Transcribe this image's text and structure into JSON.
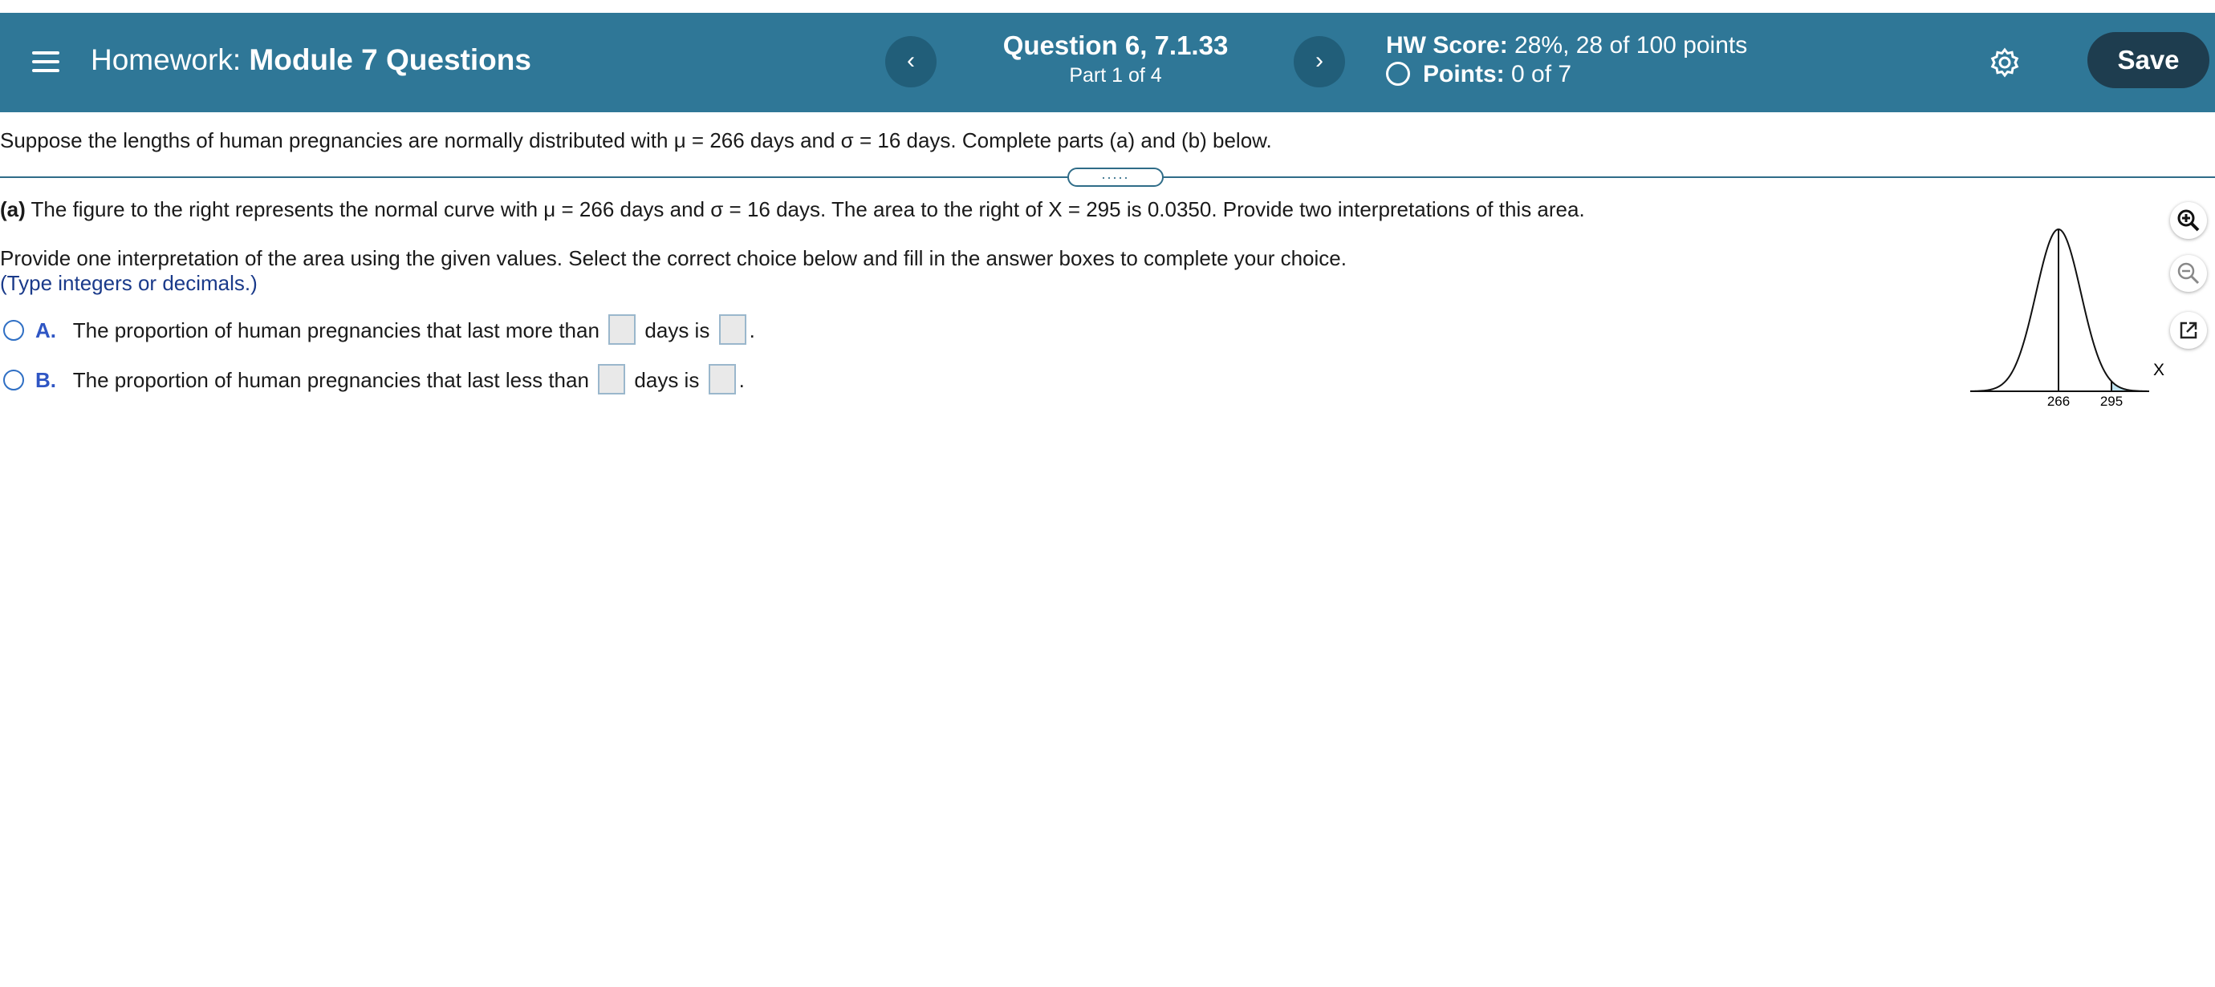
{
  "header": {
    "homework_label": "Homework:",
    "homework_name": "Module 7 Questions",
    "question_title": "Question 6, 7.1.33",
    "question_part": "Part 1 of 4",
    "score_label": "HW Score:",
    "score_value": "28%, 28 of 100 points",
    "points_label": "Points:",
    "points_value": "0 of 7",
    "prev_label": "‹",
    "next_label": "›",
    "save_label": "Save"
  },
  "question": {
    "intro": "Suppose the lengths of human pregnancies are normally distributed with μ = 266 days and σ = 16 days. Complete parts (a) and (b) below.",
    "splitter_label": ".....",
    "part_a_label": "(a)",
    "part_a_text": "The figure to the right represents the normal curve with μ = 266 days and σ = 16 days. The area to the right of X = 295 is 0.0350. Provide two interpretations of this area.",
    "instruction": "Provide one interpretation of the area using the given values. Select the correct choice below and fill in the answer boxes to complete your choice.",
    "hint": "(Type integers or decimals.)",
    "choices": [
      {
        "letter": "A.",
        "text_before": "The proportion of human pregnancies that last more than",
        "text_middle": "days is",
        "text_after": "."
      },
      {
        "letter": "B.",
        "text_before": "The proportion of human pregnancies that last less than",
        "text_middle": "days is",
        "text_after": "."
      }
    ]
  },
  "figure": {
    "mean_label": "266",
    "x_label": "295",
    "axis_label": "X",
    "shade_color": "#bfe3f0"
  },
  "icons": {
    "menu": "menu-icon",
    "settings": "gear-icon",
    "zoom_in": "zoom-in-icon",
    "zoom_out": "zoom-out-icon",
    "popout": "popout-icon"
  }
}
